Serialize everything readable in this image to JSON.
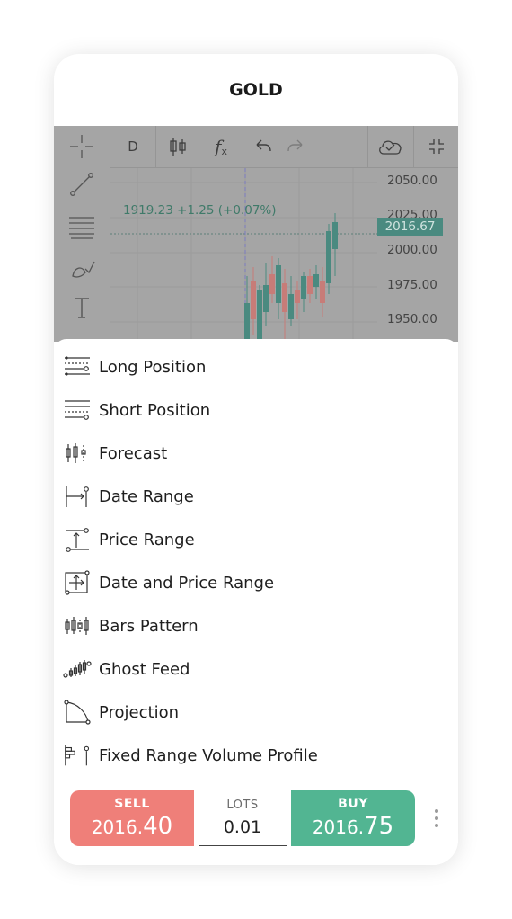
{
  "header": {
    "title": "GOLD"
  },
  "chart_toolbar": {
    "interval": "D",
    "candle_icon": "candles-icon",
    "fx_label": "f",
    "fx_sub": "x",
    "undo_icon": "undo-icon",
    "redo_icon": "redo-icon",
    "cloud_icon": "cloud-check-icon",
    "collapse_icon": "collapse-icon"
  },
  "left_tools": [
    "crosshair-icon",
    "trend-line-icon",
    "fib-icon",
    "brush-icon",
    "text-icon"
  ],
  "chart": {
    "ohlc": "1919.23  +1.25 (+0.07%)",
    "current_price": "2016.67",
    "price_labels": [
      "2050.00",
      "2025.00",
      "2000.00",
      "1975.00",
      "1950.00"
    ],
    "colors": {
      "up": "#4a8a80",
      "down": "#c77c78",
      "background": "#a5a5a5"
    }
  },
  "menu": {
    "items": [
      {
        "label": "Long Position",
        "icon": "long-position-icon"
      },
      {
        "label": "Short Position",
        "icon": "short-position-icon"
      },
      {
        "label": "Forecast",
        "icon": "forecast-icon"
      },
      {
        "label": "Date Range",
        "icon": "date-range-icon"
      },
      {
        "label": "Price Range",
        "icon": "price-range-icon"
      },
      {
        "label": "Date and Price Range",
        "icon": "date-price-range-icon"
      },
      {
        "label": "Bars Pattern",
        "icon": "bars-pattern-icon"
      },
      {
        "label": "Ghost Feed",
        "icon": "ghost-feed-icon"
      },
      {
        "label": "Projection",
        "icon": "projection-icon"
      },
      {
        "label": "Fixed Range Volume Profile",
        "icon": "volume-profile-icon"
      }
    ]
  },
  "trade": {
    "sell_label": "SELL",
    "sell_price_main": "2016.",
    "sell_price_big": "40",
    "lots_label": "LOTS",
    "lots_value": "0.01",
    "buy_label": "BUY",
    "buy_price_main": "2016.",
    "buy_price_big": "75",
    "sell_color": "#ef7f79",
    "buy_color": "#52b592"
  }
}
